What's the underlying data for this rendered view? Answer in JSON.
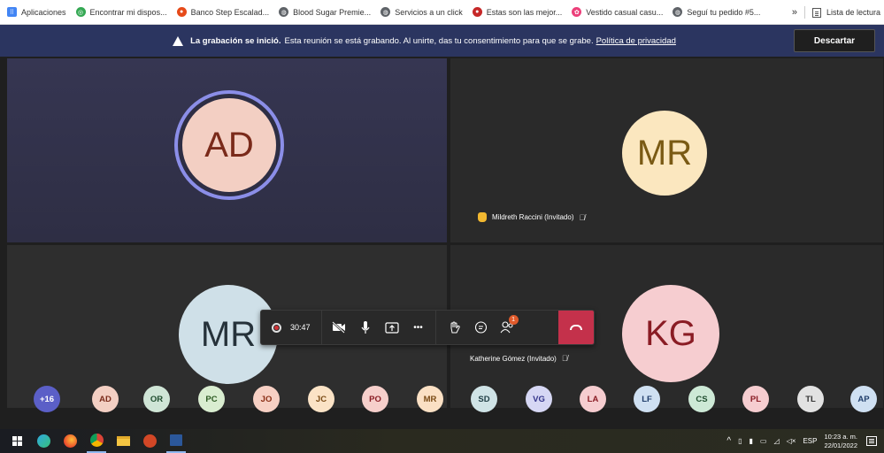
{
  "bookmarks": {
    "items": [
      {
        "label": "Aplicaciones",
        "icon": "apps-grid-icon",
        "color": "#4285f4"
      },
      {
        "label": "Encontrar mi dispos...",
        "icon": "google-find-icon",
        "color": "#34a853"
      },
      {
        "label": "Banco Step Escalad...",
        "icon": "bank-icon",
        "color": "#e64a19"
      },
      {
        "label": "Blood Sugar Premie...",
        "icon": "globe-icon",
        "color": "#5f6368"
      },
      {
        "label": "Servicios a un click",
        "icon": "globe-icon",
        "color": "#5f6368"
      },
      {
        "label": "Estas son las mejor...",
        "icon": "news-icon",
        "color": "#c62828"
      },
      {
        "label": "Vestido casual casu...",
        "icon": "shop-icon",
        "color": "#ec407a"
      },
      {
        "label": "Seguí tu pedido #5...",
        "icon": "globe-icon",
        "color": "#5f6368"
      }
    ],
    "more": "»",
    "reading_list": "Lista de lectura"
  },
  "banner": {
    "bold": "La grabación se inició.",
    "text": "Esta reunión se está grabando. Al unirte, das tu consentimiento para que se grabe.",
    "link": "Política de privacidad",
    "dismiss": "Descartar",
    "background": "#2b3560"
  },
  "tiles": {
    "ad": {
      "initials": "AD"
    },
    "mr1": {
      "initials": "MR",
      "name": "Mildreth Raccini (Invitado)"
    },
    "mr2": {
      "initials": "MR"
    },
    "kg": {
      "initials": "KG",
      "name": "Katherine Gómez (Invitado)"
    }
  },
  "controls": {
    "timer": "30:47",
    "more": "•••",
    "participants_badge": "1",
    "hangup_color": "#c4314b"
  },
  "participants": [
    {
      "label": "+16",
      "bg": "#5b5fc7",
      "fg": "#ffffff"
    },
    {
      "label": "AD",
      "bg": "#f3cfc3",
      "fg": "#7a2a1a"
    },
    {
      "label": "OR",
      "bg": "#cfe5d6",
      "fg": "#1f4d2e"
    },
    {
      "label": "PC",
      "bg": "#d9edd0",
      "fg": "#2d5a22"
    },
    {
      "label": "JO",
      "bg": "#f7d0c4",
      "fg": "#8a2d14"
    },
    {
      "label": "JC",
      "bg": "#fbe3c6",
      "fg": "#7a4a14"
    },
    {
      "label": "PO",
      "bg": "#f6cfcb",
      "fg": "#8a1c24"
    },
    {
      "label": "MR",
      "bg": "#fbe0c4",
      "fg": "#7a4a14"
    },
    {
      "label": "SD",
      "bg": "#cfe3e6",
      "fg": "#1f3d44"
    },
    {
      "label": "VG",
      "bg": "#d6d7f4",
      "fg": "#33348a"
    },
    {
      "label": "LA",
      "bg": "#f6cdd0",
      "fg": "#8a1c24"
    },
    {
      "label": "LF",
      "bg": "#cfe0f2",
      "fg": "#1f3d6a"
    },
    {
      "label": "CS",
      "bg": "#cde9d6",
      "fg": "#1f4d2e"
    },
    {
      "label": "PL",
      "bg": "#f6cdd0",
      "fg": "#8a1c24"
    },
    {
      "label": "TL",
      "bg": "#e2e2e2",
      "fg": "#333333"
    },
    {
      "label": "AP",
      "bg": "#cfe0f2",
      "fg": "#1f3d6a"
    }
  ],
  "taskbar": {
    "language": "ESP",
    "time": "10:23 a. m.",
    "date": "22/01/2022"
  }
}
